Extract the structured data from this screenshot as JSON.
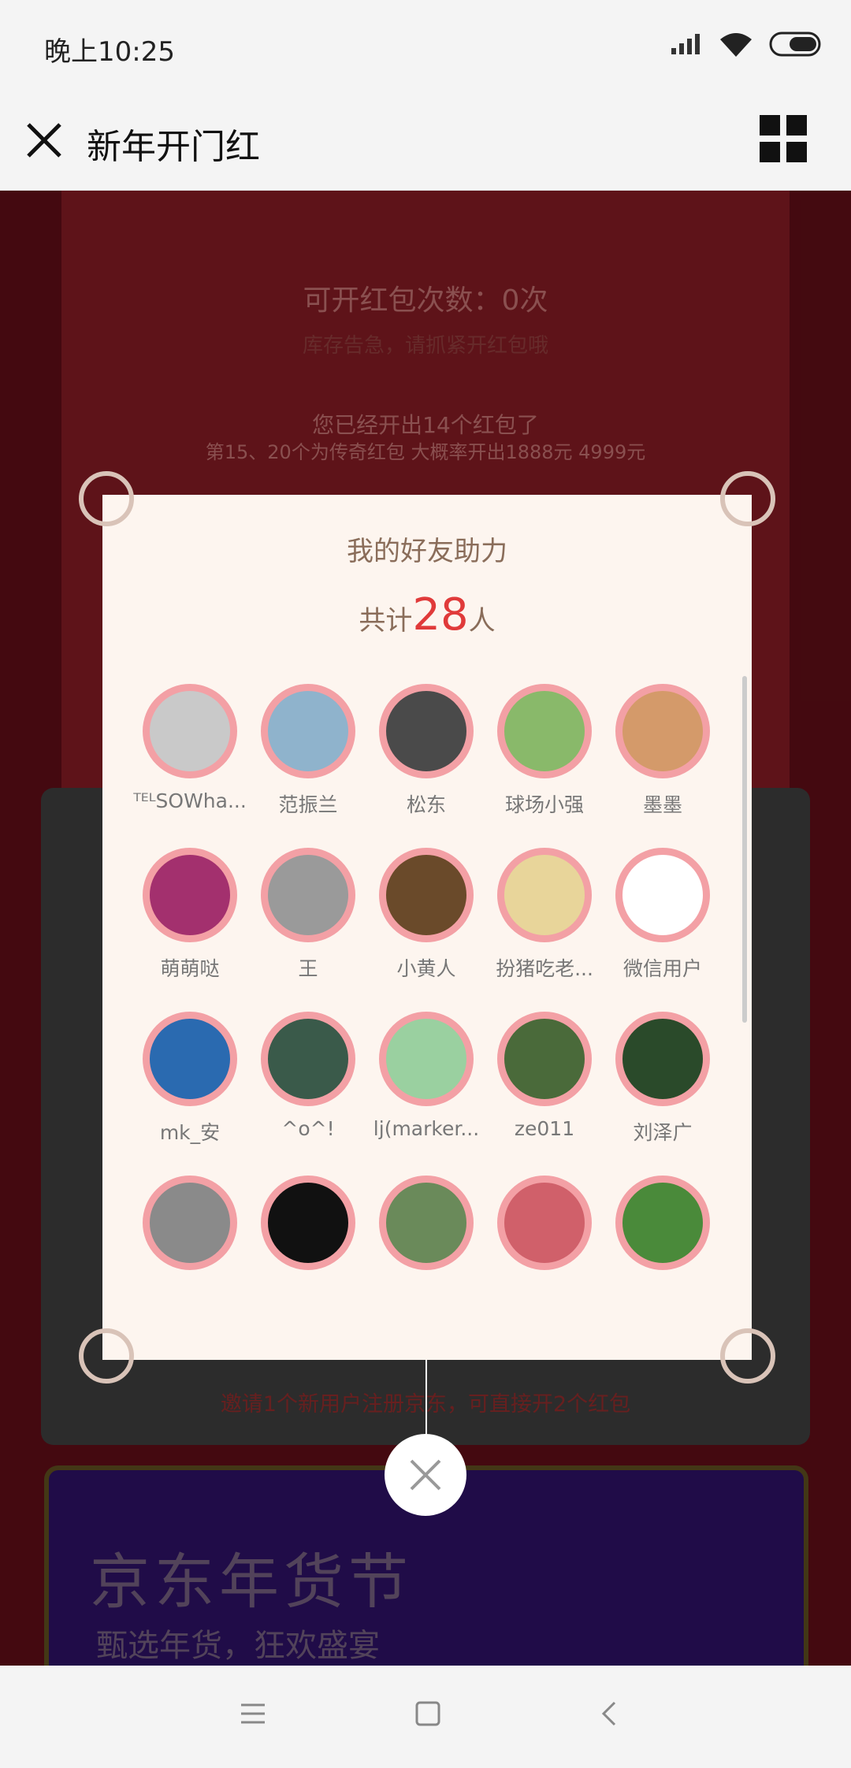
{
  "status": {
    "time": "晚上10:25"
  },
  "nav": {
    "title": "新年开门红"
  },
  "bg": {
    "count_label": "可开红包次数：0次",
    "notice": "库存告急，请抓紧开红包哦",
    "opened": "您已经开出14个红包了",
    "legend": "第15、20个为传奇红包 大概率开出1888元 4999元",
    "invite": "邀请1个新用户注册京东，可直接开2个红包",
    "banner_title": "京东年货节",
    "banner_sub": "甄选年货，狂欢盛宴"
  },
  "modal": {
    "title": "我的好友助力",
    "count_prefix": "共计",
    "count": "28",
    "count_suffix": "人",
    "friends": [
      {
        "name": "ᵀᴱᴸSOWha...",
        "color": "#c9c9c9"
      },
      {
        "name": "范振兰",
        "color": "#8fb3cc"
      },
      {
        "name": "松东",
        "color": "#4a4a4a"
      },
      {
        "name": "球场小强",
        "color": "#89b96a"
      },
      {
        "name": "墨墨",
        "color": "#d49a6a"
      },
      {
        "name": "萌萌哒",
        "color": "#a3306e"
      },
      {
        "name": "王",
        "color": "#9a9a9a"
      },
      {
        "name": "小黄人",
        "color": "#6a4a2a"
      },
      {
        "name": "扮猪吃老...",
        "color": "#e8d59a"
      },
      {
        "name": "微信用户",
        "color": "#ffffff"
      },
      {
        "name": "mk_安",
        "color": "#2a6ab0"
      },
      {
        "name": "^o^!",
        "color": "#3a5a4a"
      },
      {
        "name": "lj(marker...",
        "color": "#9ad0a0"
      },
      {
        "name": "ze011",
        "color": "#4a6a3a"
      },
      {
        "name": "刘泽广",
        "color": "#2a4a2a"
      },
      {
        "name": "",
        "color": "#8a8a8a"
      },
      {
        "name": "",
        "color": "#111111"
      },
      {
        "name": "",
        "color": "#6a8a5a"
      },
      {
        "name": "",
        "color": "#d0606a"
      },
      {
        "name": "",
        "color": "#4a8a3a"
      }
    ]
  }
}
